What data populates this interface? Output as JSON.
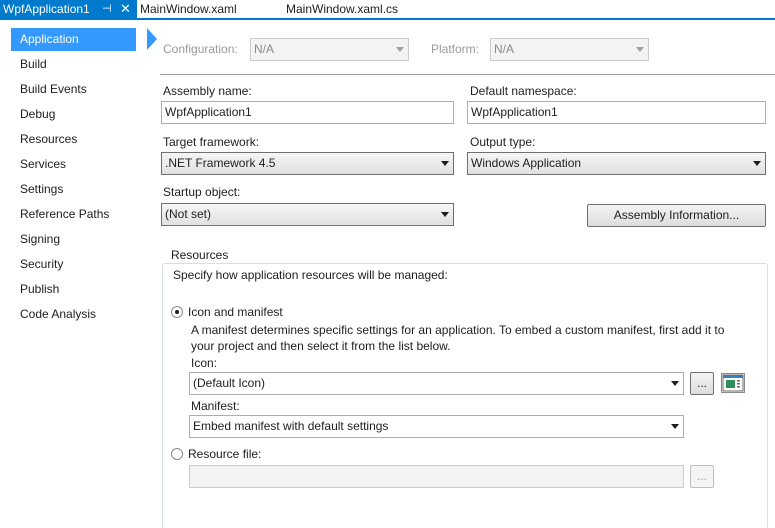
{
  "tabs": [
    {
      "label": "WpfApplication1",
      "pin": "⊣",
      "close": "✕"
    },
    {
      "label": "MainWindow.xaml"
    },
    {
      "label": "MainWindow.xaml.cs"
    }
  ],
  "sidebar": {
    "items": [
      {
        "label": "Application",
        "selected": true
      },
      {
        "label": "Build"
      },
      {
        "label": "Build Events"
      },
      {
        "label": "Debug"
      },
      {
        "label": "Resources"
      },
      {
        "label": "Services"
      },
      {
        "label": "Settings"
      },
      {
        "label": "Reference Paths"
      },
      {
        "label": "Signing"
      },
      {
        "label": "Security"
      },
      {
        "label": "Publish"
      },
      {
        "label": "Code Analysis"
      }
    ]
  },
  "config": {
    "configuration_label": "Configuration:",
    "configuration_value": "N/A",
    "platform_label": "Platform:",
    "platform_value": "N/A"
  },
  "app": {
    "assembly_name_label": "Assembly name:",
    "assembly_name_value": "WpfApplication1",
    "default_namespace_label": "Default namespace:",
    "default_namespace_value": "WpfApplication1",
    "target_framework_label": "Target framework:",
    "target_framework_value": ".NET Framework 4.5",
    "output_type_label": "Output type:",
    "output_type_value": "Windows Application",
    "startup_object_label": "Startup object:",
    "startup_object_value": "(Not set)",
    "assembly_info_button": "Assembly Information..."
  },
  "resources": {
    "group_title": "Resources",
    "instructions": "Specify how application resources will be managed:",
    "icon_manifest_option": "Icon and manifest",
    "icon_manifest_desc": "A manifest determines specific settings for an application. To embed a custom manifest, first add it to your project and then select it from the list below.",
    "icon_label": "Icon:",
    "icon_value": "(Default Icon)",
    "browse_button": "...",
    "manifest_label": "Manifest:",
    "manifest_value": "Embed manifest with default settings",
    "resource_file_option": "Resource file:",
    "resource_file_value": "",
    "resource_browse_button": "..."
  },
  "colors": {
    "accent": "#007acc",
    "selection": "#3399ff"
  }
}
